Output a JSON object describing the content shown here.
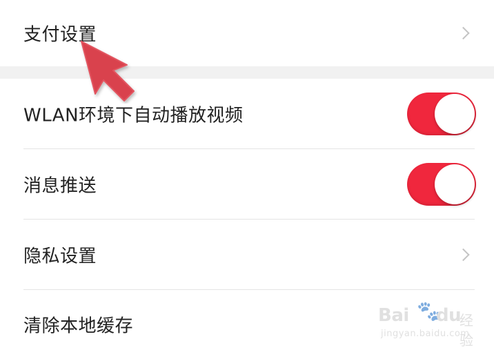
{
  "settings": {
    "payment": {
      "label": "支付设置",
      "icon": "chevron-right-icon"
    },
    "wlan_autoplay": {
      "label": "WLAN环境下自动播放视频",
      "enabled": true
    },
    "push": {
      "label": "消息推送",
      "enabled": true
    },
    "privacy": {
      "label": "隐私设置",
      "icon": "chevron-right-icon"
    },
    "clear_cache": {
      "label": "清除本地缓存"
    }
  },
  "colors": {
    "toggle_on": "#f0273d",
    "annotation_arrow": "#d9434e",
    "section_gap": "#f1f1f1"
  },
  "watermark": {
    "brand": "Bai",
    "brand_suffix": "du",
    "product": "经验",
    "url": "jingyan.baidu.com"
  }
}
